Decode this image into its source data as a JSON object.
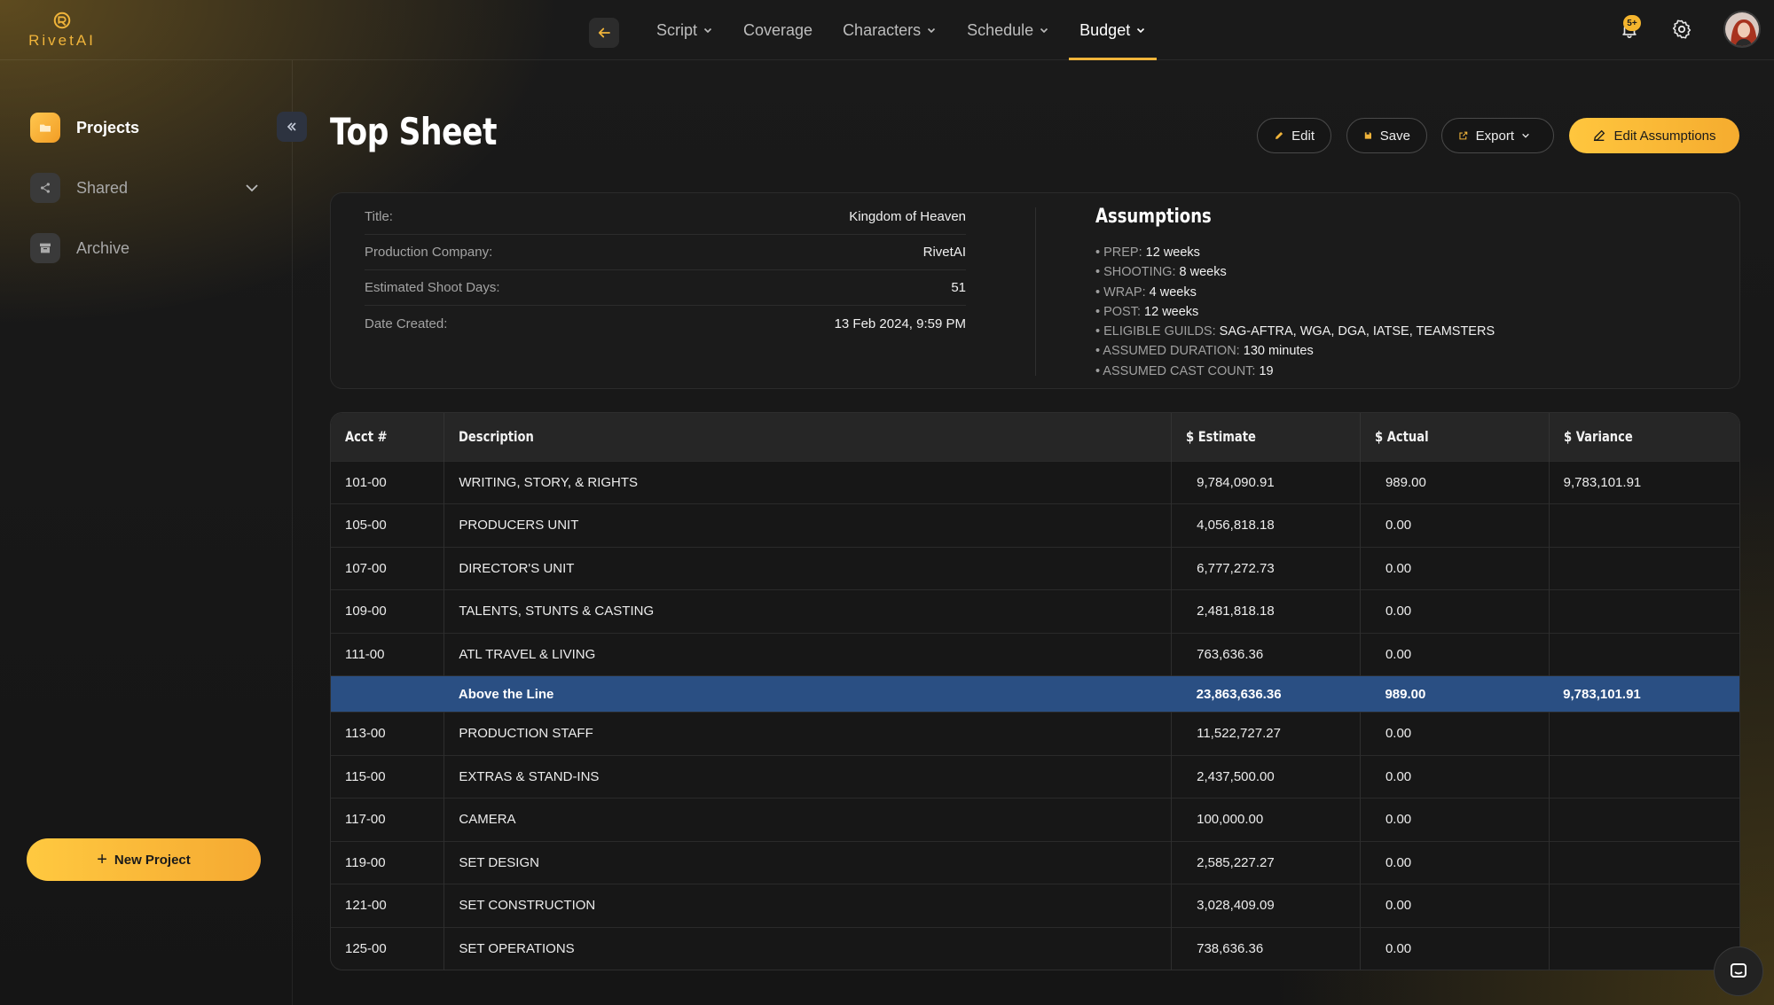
{
  "brand": {
    "name": "RivetAI",
    "accent": "#f0b43a"
  },
  "nav": {
    "items": [
      {
        "label": "Script",
        "dropdown": true
      },
      {
        "label": "Coverage",
        "dropdown": false
      },
      {
        "label": "Characters",
        "dropdown": true
      },
      {
        "label": "Schedule",
        "dropdown": true
      },
      {
        "label": "Budget",
        "dropdown": true,
        "active": true
      }
    ],
    "notification_badge": "5+"
  },
  "sidebar": {
    "items": [
      {
        "label": "Projects",
        "icon": "folder-icon",
        "active": true
      },
      {
        "label": "Shared",
        "icon": "share-icon",
        "active": false
      },
      {
        "label": "Archive",
        "icon": "archive-icon",
        "active": false
      }
    ],
    "new_project_label": "New Project"
  },
  "page": {
    "title": "Top Sheet",
    "actions": {
      "edit": "Edit",
      "save": "Save",
      "export": "Export",
      "edit_assumptions": "Edit Assumptions"
    }
  },
  "info": {
    "rows": [
      {
        "label": "Title:",
        "value": "Kingdom of Heaven"
      },
      {
        "label": "Production Company:",
        "value": "RivetAI"
      },
      {
        "label": "Estimated Shoot Days:",
        "value": "51"
      },
      {
        "label": "Date Created:",
        "value": "13 Feb 2024, 9:59 PM"
      }
    ],
    "assumptions_title": "Assumptions",
    "assumptions": [
      {
        "key": "• PREP:",
        "value": "12 weeks"
      },
      {
        "key": "• SHOOTING:",
        "value": "8 weeks"
      },
      {
        "key": "• WRAP:",
        "value": "4 weeks"
      },
      {
        "key": "• POST:",
        "value": "12 weeks"
      },
      {
        "key": "• ELIGIBLE GUILDS:",
        "value": "SAG-AFTRA, WGA, DGA, IATSE, TEAMSTERS"
      },
      {
        "key": "• ASSUMED DURATION:",
        "value": "130 minutes"
      },
      {
        "key": "• ASSUMED CAST COUNT:",
        "value": "19"
      }
    ]
  },
  "table": {
    "headers": [
      "Acct #",
      "Description",
      "$ Estimate",
      "$ Actual",
      "$ Variance"
    ],
    "rows": [
      {
        "acct": "101-00",
        "desc": "WRITING, STORY, & RIGHTS",
        "estimate": "9,784,090.91",
        "actual": "989.00",
        "variance": "9,783,101.91"
      },
      {
        "acct": "105-00",
        "desc": "PRODUCERS UNIT",
        "estimate": "4,056,818.18",
        "actual": "0.00",
        "variance": ""
      },
      {
        "acct": "107-00",
        "desc": "DIRECTOR'S UNIT",
        "estimate": "6,777,272.73",
        "actual": "0.00",
        "variance": ""
      },
      {
        "acct": "109-00",
        "desc": "TALENTS, STUNTS & CASTING",
        "estimate": "2,481,818.18",
        "actual": "0.00",
        "variance": ""
      },
      {
        "acct": "111-00",
        "desc": "ATL TRAVEL & LIVING",
        "estimate": "763,636.36",
        "actual": "0.00",
        "variance": ""
      },
      {
        "acct": "",
        "desc": "Above the Line",
        "estimate": "23,863,636.36",
        "actual": "989.00",
        "variance": "9,783,101.91",
        "subtotal": true
      },
      {
        "acct": "113-00",
        "desc": "PRODUCTION STAFF",
        "estimate": "11,522,727.27",
        "actual": "0.00",
        "variance": ""
      },
      {
        "acct": "115-00",
        "desc": "EXTRAS & STAND-INS",
        "estimate": "2,437,500.00",
        "actual": "0.00",
        "variance": ""
      },
      {
        "acct": "117-00",
        "desc": "CAMERA",
        "estimate": "100,000.00",
        "actual": "0.00",
        "variance": ""
      },
      {
        "acct": "119-00",
        "desc": "SET DESIGN",
        "estimate": "2,585,227.27",
        "actual": "0.00",
        "variance": ""
      },
      {
        "acct": "121-00",
        "desc": "SET CONSTRUCTION",
        "estimate": "3,028,409.09",
        "actual": "0.00",
        "variance": ""
      },
      {
        "acct": "125-00",
        "desc": "SET OPERATIONS",
        "estimate": "738,636.36",
        "actual": "0.00",
        "variance": ""
      }
    ]
  }
}
